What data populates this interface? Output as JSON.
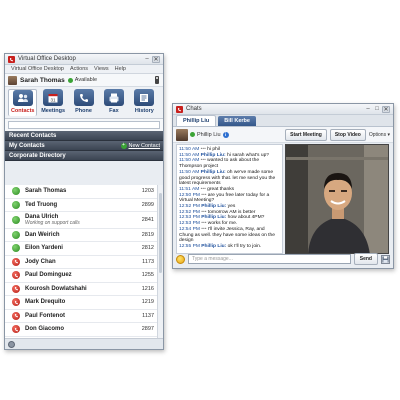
{
  "vod": {
    "title": "Virtual Office Desktop",
    "menu": [
      "Virtual Office Desktop",
      "Actions",
      "Views",
      "Help"
    ],
    "user": {
      "name": "Sarah Thomas",
      "status": "Available"
    },
    "tabs": [
      "Contacts",
      "Meetings",
      "Phone",
      "Fax",
      "History"
    ],
    "search_placeholder": "",
    "sections": {
      "recent": "Recent Contacts",
      "my": "My Contacts",
      "new_contact": "New Contact",
      "corporate": "Corporate Directory"
    },
    "contacts": [
      {
        "name": "Sarah Thomas",
        "sub": "",
        "ext": "1203",
        "status": "green"
      },
      {
        "name": "Ted Truong",
        "sub": "",
        "ext": "2899",
        "status": "green"
      },
      {
        "name": "Dana Ulrich",
        "sub": "Working on support calls",
        "ext": "2841",
        "status": "green"
      },
      {
        "name": "Dan Weirich",
        "sub": "",
        "ext": "2819",
        "status": "green"
      },
      {
        "name": "Eilon Yardeni",
        "sub": "",
        "ext": "2812",
        "status": "green"
      },
      {
        "name": "Jody Chan",
        "sub": "",
        "ext": "1173",
        "status": "red"
      },
      {
        "name": "Paul Dominguez",
        "sub": "",
        "ext": "1255",
        "status": "red"
      },
      {
        "name": "Kourosh Dowlatshahi",
        "sub": "",
        "ext": "1216",
        "status": "red"
      },
      {
        "name": "Mark Drequito",
        "sub": "",
        "ext": "1219",
        "status": "red"
      },
      {
        "name": "Paul Fontenot",
        "sub": "",
        "ext": "1137",
        "status": "red"
      },
      {
        "name": "Don Giacomo",
        "sub": "",
        "ext": "2897",
        "status": "red"
      },
      {
        "name": "",
        "sub": "",
        "ext": "",
        "status": "red"
      }
    ]
  },
  "chats": {
    "title": "Chats",
    "tabs": [
      "Phillip Liu",
      "Bill Kerbe"
    ],
    "contact_name": "Phillip Liu",
    "buttons": {
      "start_meeting": "Start Meeting",
      "stop_video": "Stop Video",
      "options": "Options"
    },
    "messages": [
      {
        "time": "11:50 AM",
        "who": "",
        "text": "hi phil"
      },
      {
        "time": "11:50 AM",
        "who": "Phillip Liu:",
        "text": "hi sarah what's up?"
      },
      {
        "time": "11:50 AM",
        "who": "",
        "text": "wanted to ask about the Thompson project"
      },
      {
        "time": "11:50 AM",
        "who": "Phillip Liu:",
        "text": "oh we've made some good progress with that. let me send you the latest requirements"
      },
      {
        "time": "11:51 AM",
        "who": "",
        "text": "great thanks"
      },
      {
        "time": "12:50 PM",
        "who": "",
        "text": "are you free later today for a Virtual Meeting?"
      },
      {
        "time": "12:52 PM",
        "who": "Phillip Liu:",
        "text": "yes"
      },
      {
        "time": "12:52 PM",
        "who": "",
        "text": "tomorrow AM is better"
      },
      {
        "time": "12:53 PM",
        "who": "Phillip Liu:",
        "text": "how about 4PM?"
      },
      {
        "time": "12:53 PM",
        "who": "",
        "text": "works for me."
      },
      {
        "time": "12:54 PM",
        "who": "",
        "text": "I'll invite Jessica, Ray, and Chung as well. they have some ideas on the design"
      },
      {
        "time": "12:55 PM",
        "who": "Phillip Liu:",
        "text": "ok I'll try to join."
      }
    ],
    "input_placeholder": "Type a message...",
    "send": "Send"
  }
}
